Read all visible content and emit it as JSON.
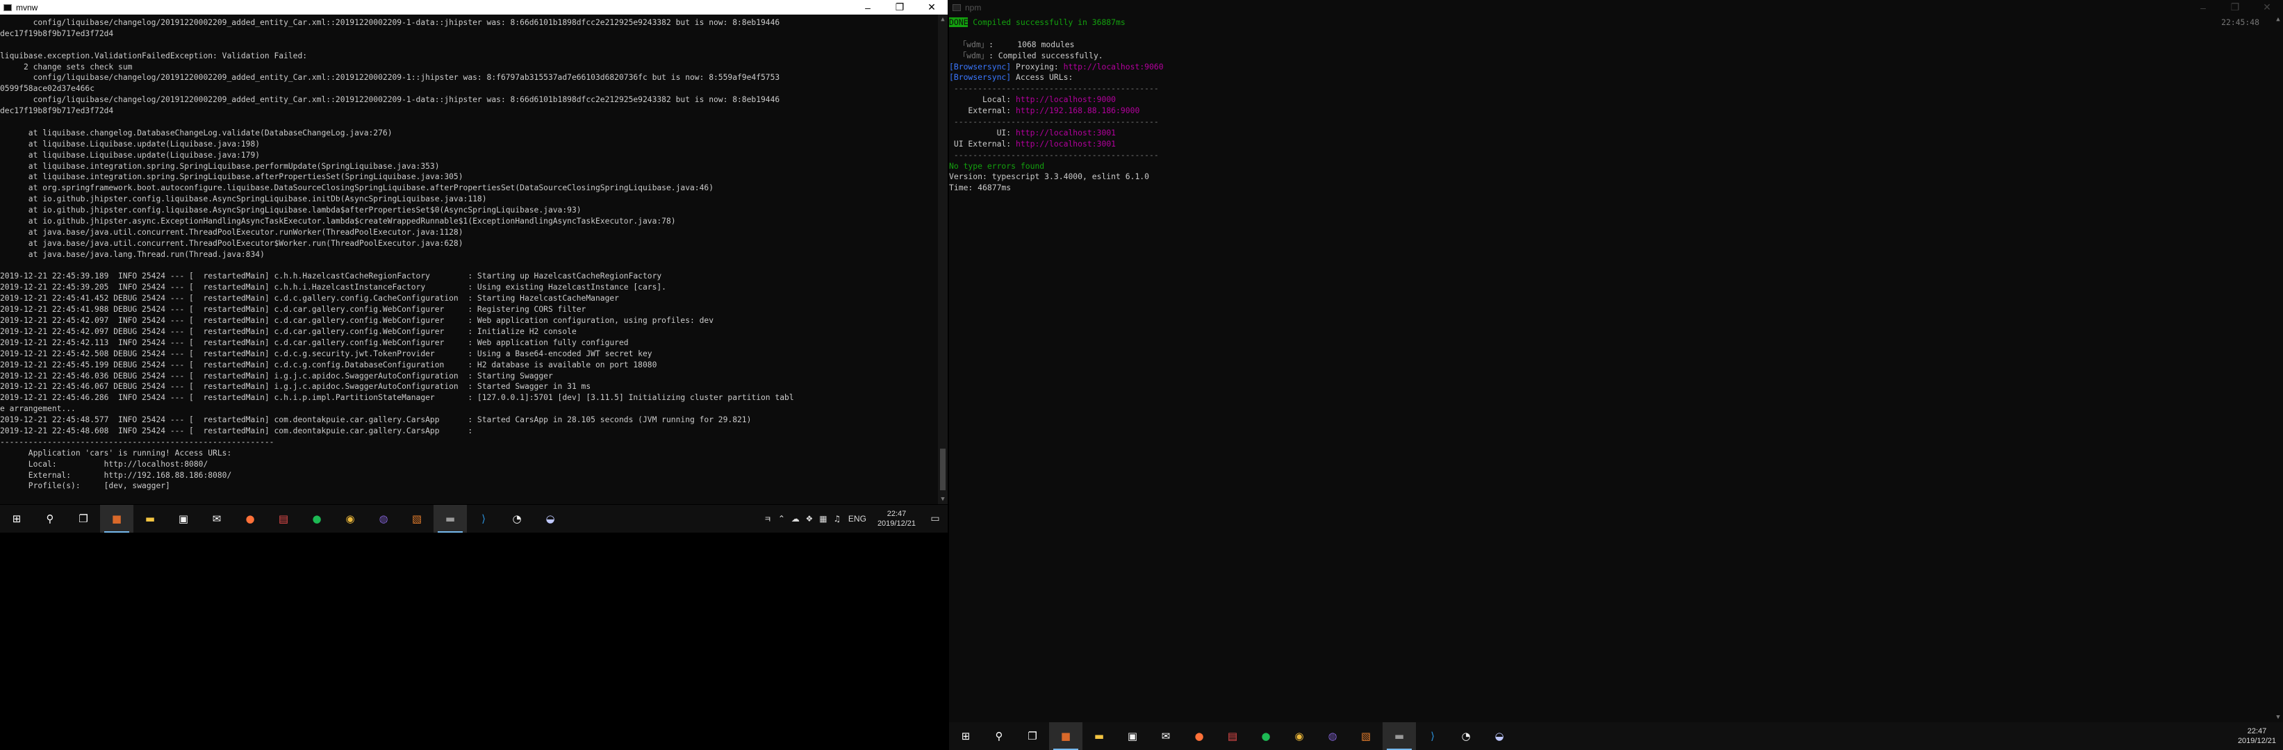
{
  "left_window": {
    "title": "mvnw",
    "lines": [
      "       config/liquibase/changelog/20191220002209_added_entity_Car.xml::20191220002209-1-data::jhipster was: 8:66d6101b1898dfcc2e212925e9243382 but is now: 8:8eb19446",
      "dec17f19b8f9b717ed3f72d4",
      "",
      "liquibase.exception.ValidationFailedException: Validation Failed:",
      "     2 change sets check sum",
      "       config/liquibase/changelog/20191220002209_added_entity_Car.xml::20191220002209-1::jhipster was: 8:f6797ab315537ad7e66103d6820736fc but is now: 8:559af9e4f5753",
      "0599f58ace02d37e466c",
      "       config/liquibase/changelog/20191220002209_added_entity_Car.xml::20191220002209-1-data::jhipster was: 8:66d6101b1898dfcc2e212925e9243382 but is now: 8:8eb19446",
      "dec17f19b8f9b717ed3f72d4",
      "",
      "      at liquibase.changelog.DatabaseChangeLog.validate(DatabaseChangeLog.java:276)",
      "      at liquibase.Liquibase.update(Liquibase.java:198)",
      "      at liquibase.Liquibase.update(Liquibase.java:179)",
      "      at liquibase.integration.spring.SpringLiquibase.performUpdate(SpringLiquibase.java:353)",
      "      at liquibase.integration.spring.SpringLiquibase.afterPropertiesSet(SpringLiquibase.java:305)",
      "      at org.springframework.boot.autoconfigure.liquibase.DataSourceClosingSpringLiquibase.afterPropertiesSet(DataSourceClosingSpringLiquibase.java:46)",
      "      at io.github.jhipster.config.liquibase.AsyncSpringLiquibase.initDb(AsyncSpringLiquibase.java:118)",
      "      at io.github.jhipster.config.liquibase.AsyncSpringLiquibase.lambda$afterPropertiesSet$0(AsyncSpringLiquibase.java:93)",
      "      at io.github.jhipster.async.ExceptionHandlingAsyncTaskExecutor.lambda$createWrappedRunnable$1(ExceptionHandlingAsyncTaskExecutor.java:78)",
      "      at java.base/java.util.concurrent.ThreadPoolExecutor.runWorker(ThreadPoolExecutor.java:1128)",
      "      at java.base/java.util.concurrent.ThreadPoolExecutor$Worker.run(ThreadPoolExecutor.java:628)",
      "      at java.base/java.lang.Thread.run(Thread.java:834)",
      "",
      "2019-12-21 22:45:39.189  INFO 25424 --- [  restartedMain] c.h.h.HazelcastCacheRegionFactory        : Starting up HazelcastCacheRegionFactory",
      "2019-12-21 22:45:39.205  INFO 25424 --- [  restartedMain] c.h.h.i.HazelcastInstanceFactory         : Using existing HazelcastInstance [cars].",
      "2019-12-21 22:45:41.452 DEBUG 25424 --- [  restartedMain] c.d.c.gallery.config.CacheConfiguration  : Starting HazelcastCacheManager",
      "2019-12-21 22:45:41.988 DEBUG 25424 --- [  restartedMain] c.d.car.gallery.config.WebConfigurer     : Registering CORS filter",
      "2019-12-21 22:45:42.097  INFO 25424 --- [  restartedMain] c.d.car.gallery.config.WebConfigurer     : Web application configuration, using profiles: dev",
      "2019-12-21 22:45:42.097 DEBUG 25424 --- [  restartedMain] c.d.car.gallery.config.WebConfigurer     : Initialize H2 console",
      "2019-12-21 22:45:42.113  INFO 25424 --- [  restartedMain] c.d.car.gallery.config.WebConfigurer     : Web application fully configured",
      "2019-12-21 22:45:42.508 DEBUG 25424 --- [  restartedMain] c.d.c.g.security.jwt.TokenProvider       : Using a Base64-encoded JWT secret key",
      "2019-12-21 22:45:45.199 DEBUG 25424 --- [  restartedMain] c.d.c.g.config.DatabaseConfiguration     : H2 database is available on port 18080",
      "2019-12-21 22:45:46.036 DEBUG 25424 --- [  restartedMain] i.g.j.c.apidoc.SwaggerAutoConfiguration  : Starting Swagger",
      "2019-12-21 22:45:46.067 DEBUG 25424 --- [  restartedMain] i.g.j.c.apidoc.SwaggerAutoConfiguration  : Started Swagger in 31 ms",
      "2019-12-21 22:45:46.286  INFO 25424 --- [  restartedMain] c.h.i.p.impl.PartitionStateManager       : [127.0.0.1]:5701 [dev] [3.11.5] Initializing cluster partition tabl",
      "e arrangement...",
      "2019-12-21 22:45:48.577  INFO 25424 --- [  restartedMain] com.deontakpuie.car.gallery.CarsApp      : Started CarsApp in 28.105 seconds (JVM running for 29.821)",
      "2019-12-21 22:45:48.608  INFO 25424 --- [  restartedMain] com.deontakpuie.car.gallery.CarsApp      :",
      "----------------------------------------------------------",
      "      Application 'cars' is running! Access URLs:",
      "      Local:          http://localhost:8080/",
      "      External:       http://192.168.88.186:8080/",
      "      Profile(s):     [dev, swagger]"
    ]
  },
  "right_window": {
    "title": "npm",
    "clock": "22:45:48",
    "done_badge": "DONE",
    "done_text": " Compiled successfully in 36887ms",
    "lines": [
      {
        "parts": [
          {
            "t": ""
          }
        ]
      },
      {
        "parts": [
          {
            "t": "  ",
            "c": ""
          },
          {
            "t": "「wdm」",
            "c": "gray"
          },
          {
            "t": ":     1068 modules"
          }
        ]
      },
      {
        "parts": [
          {
            "t": "  ",
            "c": ""
          },
          {
            "t": "「wdm」",
            "c": "gray"
          },
          {
            "t": ": Compiled successfully."
          }
        ]
      },
      {
        "parts": [
          {
            "t": "[Browsersync]",
            "c": "blue"
          },
          {
            "t": " Proxying: "
          },
          {
            "t": "http://localhost:9060",
            "c": "magenta"
          }
        ]
      },
      {
        "parts": [
          {
            "t": "[Browsersync]",
            "c": "blue"
          },
          {
            "t": " Access URLs:"
          }
        ]
      },
      {
        "parts": [
          {
            "t": " -------------------------------------------",
            "c": "gray"
          }
        ]
      },
      {
        "parts": [
          {
            "t": "       Local: "
          },
          {
            "t": "http://localhost:9000",
            "c": "magenta"
          }
        ]
      },
      {
        "parts": [
          {
            "t": "    External: "
          },
          {
            "t": "http://192.168.88.186:9000",
            "c": "magenta"
          }
        ]
      },
      {
        "parts": [
          {
            "t": " -------------------------------------------",
            "c": "gray"
          }
        ]
      },
      {
        "parts": [
          {
            "t": "          UI: "
          },
          {
            "t": "http://localhost:3001",
            "c": "magenta"
          }
        ]
      },
      {
        "parts": [
          {
            "t": " UI External: "
          },
          {
            "t": "http://localhost:3001",
            "c": "magenta"
          }
        ]
      },
      {
        "parts": [
          {
            "t": " -------------------------------------------",
            "c": "gray"
          }
        ]
      },
      {
        "parts": [
          {
            "t": "No type errors found",
            "c": "green"
          }
        ]
      },
      {
        "parts": [
          {
            "t": "Version: typescript 3.3.4000, eslint 6.1.0"
          }
        ]
      },
      {
        "parts": [
          {
            "t": "Time: 46877ms"
          }
        ]
      }
    ]
  },
  "taskbar_left": {
    "time": "22:47",
    "date": "2019/12/21",
    "lang": "ENG"
  },
  "taskbar_right": {
    "time": "22:47",
    "date": "2019/12/21"
  },
  "colors": {
    "terminal_bg": "#0c0c0c",
    "taskbar_bg": "#101010",
    "done_green": "#13a10e",
    "browsersync_blue": "#3b78ff",
    "url_magenta": "#b4009e"
  },
  "taskbar_icons": [
    {
      "name": "start-icon",
      "glyph": "⊞",
      "color": "#ffffff"
    },
    {
      "name": "search-icon",
      "glyph": "⚲",
      "color": "#ffffff"
    },
    {
      "name": "task-view-icon",
      "glyph": "❐",
      "color": "#ffffff"
    },
    {
      "name": "app-orange-icon",
      "glyph": "■",
      "color": "#d9692a",
      "active": true
    },
    {
      "name": "file-explorer-icon",
      "glyph": "▬",
      "color": "#f4c542"
    },
    {
      "name": "store-icon",
      "glyph": "▣",
      "color": "#f2f2f2"
    },
    {
      "name": "mail-icon",
      "glyph": "✉",
      "color": "#ffffff"
    },
    {
      "name": "firefox-icon",
      "glyph": "●",
      "color": "#ff7139"
    },
    {
      "name": "gift-app-icon",
      "glyph": "▤",
      "color": "#e64c4c"
    },
    {
      "name": "spotify-icon",
      "glyph": "●",
      "color": "#1db954"
    },
    {
      "name": "chrome-icon",
      "glyph": "◉",
      "color": "#e8b53a"
    },
    {
      "name": "media-app-icon",
      "glyph": "◍",
      "color": "#7a5cc7"
    },
    {
      "name": "app-box-icon",
      "glyph": "▧",
      "color": "#e07b2c"
    },
    {
      "name": "terminal-icon",
      "glyph": "▬",
      "color": "#9a9a9a",
      "active": true
    },
    {
      "name": "vscode-icon",
      "glyph": "⟩",
      "color": "#2a8fd8"
    },
    {
      "name": "game-app-icon",
      "glyph": "◔",
      "color": "#f0f0f0"
    },
    {
      "name": "app-cloud-icon",
      "glyph": "◒",
      "color": "#bfc8ff"
    }
  ],
  "tray_icons_left": [
    {
      "name": "ime-icon",
      "glyph": "ㅋ"
    },
    {
      "name": "chevron-up-icon",
      "glyph": "⌃"
    },
    {
      "name": "cloud-icon",
      "glyph": "☁"
    },
    {
      "name": "dropbox-icon",
      "glyph": "❖"
    },
    {
      "name": "network-icon",
      "glyph": "▦"
    },
    {
      "name": "volume-icon",
      "glyph": "♫"
    }
  ]
}
